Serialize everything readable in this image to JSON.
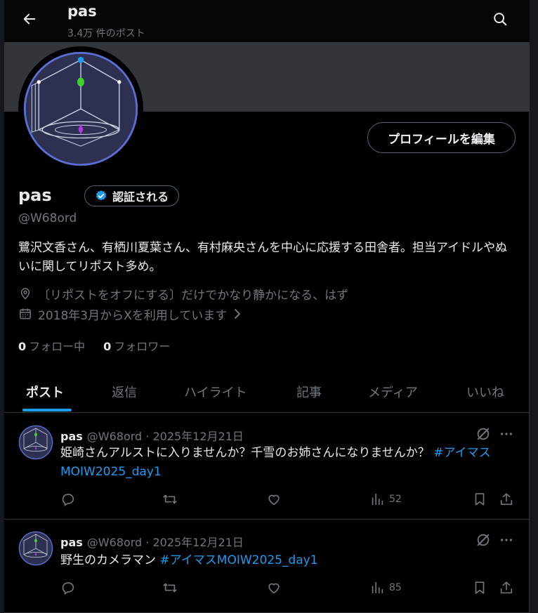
{
  "header": {
    "name": "pas",
    "post_count": "3.4万 件のポスト"
  },
  "profile": {
    "display_name": "pas",
    "verify_label": "認証される",
    "handle": "@W68ord",
    "bio": "鷺沢文香さん、有栖川夏葉さん、有村麻央さんを中心に応援する田舎者。担当アイドルやぬいに関してリポスト多め。",
    "location": "〔リポストをオフにする〕だけでかなり静かになる、はず",
    "joined": "2018年3月からXを利用しています",
    "edit_button": "プロフィールを編集",
    "following_count": "0",
    "following_label": "フォロー中",
    "followers_count": "0",
    "followers_label": "フォロワー"
  },
  "tabs": [
    {
      "label": "ポスト",
      "active": true
    },
    {
      "label": "返信"
    },
    {
      "label": "ハイライト"
    },
    {
      "label": "記事"
    },
    {
      "label": "メディア"
    },
    {
      "label": "いいね"
    }
  ],
  "posts": [
    {
      "name": "pas",
      "meta": "@W68ord · 2025年12月21日",
      "text": "姫崎さんアルストに入りませんか？千雪のお姉さんになりませんか？ ",
      "hashtag": "#アイマスMOIW2025_day1",
      "views": "52"
    },
    {
      "name": "pas",
      "meta": "@W68ord · 2025年12月21日",
      "text": "野生のカメラマン ",
      "hashtag": "#アイマスMOIW2025_day1",
      "views": "85"
    }
  ],
  "colors": {
    "accent": "#1d9bf0",
    "muted": "#71767b",
    "text": "#e7e9ea",
    "banner": "#333639"
  },
  "icons": [
    "back-arrow-icon",
    "search-icon",
    "verified-badge-icon",
    "location-icon",
    "calendar-icon",
    "chevron-right-icon",
    "grok-icon",
    "more-icon",
    "reply-icon",
    "repost-icon",
    "like-icon",
    "views-icon",
    "bookmark-icon",
    "share-icon"
  ]
}
